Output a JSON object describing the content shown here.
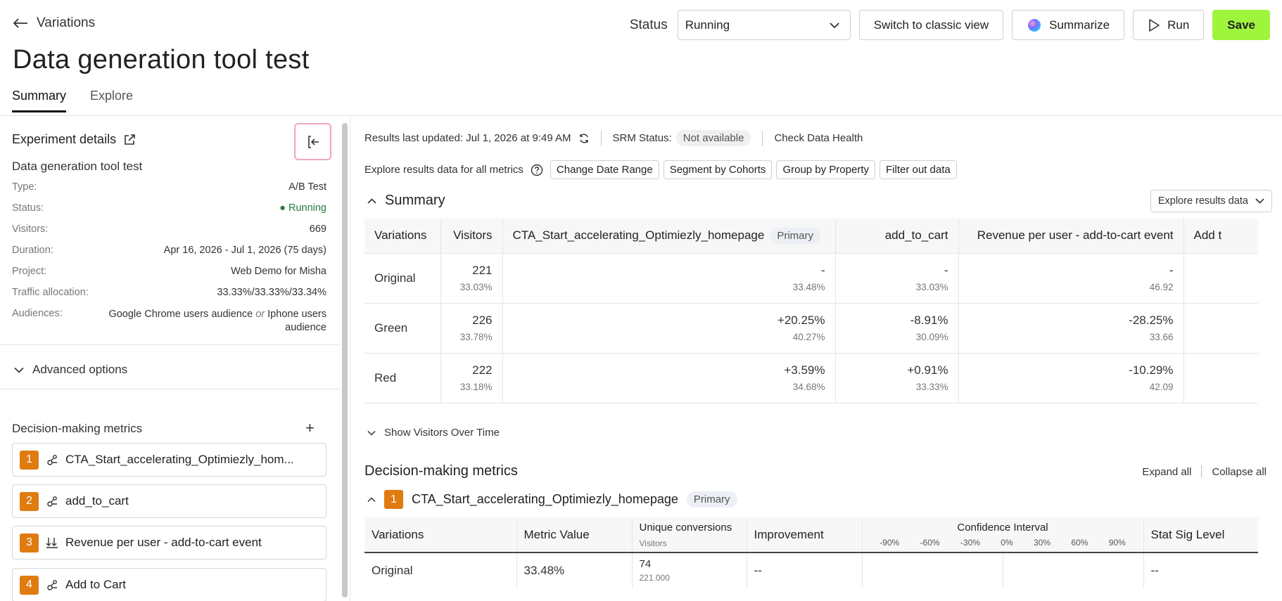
{
  "header": {
    "back_label": "Variations",
    "title": "Data generation tool test",
    "status_label": "Status",
    "status_value": "Running",
    "classic_view_label": "Switch to classic view",
    "summarize_label": "Summarize",
    "run_label": "Run",
    "save_label": "Save",
    "save_color": "#9ef53c"
  },
  "tabs": [
    {
      "label": "Summary",
      "active": true
    },
    {
      "label": "Explore",
      "active": false
    }
  ],
  "sidebar": {
    "details_title": "Experiment details",
    "experiment_name": "Data generation tool test",
    "details": {
      "type_key": "Type:",
      "type_val": "A/B Test",
      "status_key": "Status:",
      "status_val": "● Running",
      "visitors_key": "Visitors:",
      "visitors_val": "669",
      "duration_key": "Duration:",
      "duration_val": "Apr 16, 2026 - Jul 1, 2026 (75 days)",
      "project_key": "Project:",
      "project_val": "Web Demo for Misha",
      "traffic_key": "Traffic allocation:",
      "traffic_val": "33.33%/33.33%/33.34%",
      "audiences_key": "Audiences:",
      "audience_1": "Google Chrome users audience",
      "audience_or": "or",
      "audience_2a": "Iphone users",
      "audience_2b": "audience"
    },
    "advanced_label": "Advanced options",
    "metrics_title": "Decision-making metrics",
    "metrics": [
      {
        "num": "1",
        "name": "CTA_Start_accelerating_Optimiezly_hom...",
        "icon": "conversion-icon"
      },
      {
        "num": "2",
        "name": "add_to_cart",
        "icon": "conversion-icon"
      },
      {
        "num": "3",
        "name": "Revenue per user - add-to-cart event",
        "icon": "revenue-icon"
      },
      {
        "num": "4",
        "name": "Add to Cart",
        "icon": "conversion-icon"
      }
    ]
  },
  "results": {
    "last_updated": "Results last updated: Jul 1, 2026 at 9:49 AM",
    "srm_label": "SRM Status:",
    "srm_value": "Not available",
    "check_health": "Check Data Health",
    "explore_all": "Explore results data for all metrics",
    "chips": [
      "Change Date Range",
      "Segment by Cohorts",
      "Group by Property",
      "Filter out data"
    ],
    "summary_title": "Summary",
    "explore_dropdown": "Explore results data"
  },
  "summary_table": {
    "headers": {
      "variations": "Variations",
      "visitors": "Visitors",
      "metric1": "CTA_Start_accelerating_Optimiezly_homepage",
      "primary": "Primary",
      "metric2": "add_to_cart",
      "metric3": "Revenue per user - add-to-cart event",
      "metric4": "Add t"
    },
    "rows": [
      {
        "name": "Original",
        "visitors": "221",
        "visitors_pct": "33.03%",
        "m1": "-",
        "m1_sub": "33.48%",
        "m2": "-",
        "m2_sub": "33.03%",
        "m3": "-",
        "m3_sub": "46.92"
      },
      {
        "name": "Green",
        "visitors": "226",
        "visitors_pct": "33.78%",
        "m1": "+20.25%",
        "m1_sub": "40.27%",
        "m2": "-8.91%",
        "m2_sub": "30.09%",
        "m3": "-28.25%",
        "m3_sub": "33.66"
      },
      {
        "name": "Red",
        "visitors": "222",
        "visitors_pct": "33.18%",
        "m1": "+3.59%",
        "m1_sub": "34.68%",
        "m2": "+0.91%",
        "m2_sub": "33.33%",
        "m3": "-10.29%",
        "m3_sub": "42.09"
      }
    ]
  },
  "show_visitors": "Show Visitors Over Time",
  "decision_metrics": {
    "title": "Decision-making metrics",
    "expand_all": "Expand all",
    "collapse_all": "Collapse all",
    "metric_num": "1",
    "metric_name": "CTA_Start_accelerating_Optimiezly_homepage",
    "primary": "Primary",
    "headers": {
      "variations": "Variations",
      "metric_value": "Metric Value",
      "unique_conv": "Unique conversions",
      "unique_conv_sub": "Visitors",
      "improvement": "Improvement",
      "ci": "Confidence Interval",
      "ci_ticks": [
        "-90%",
        "-60%",
        "-30%",
        "0%",
        "30%",
        "60%",
        "90%"
      ],
      "stat_sig": "Stat Sig Level"
    },
    "rows": [
      {
        "name": "Original",
        "metric_value": "33.48%",
        "conversions": "74",
        "visitors": "221.000",
        "improvement": "--",
        "stat_sig": "--"
      }
    ]
  },
  "colors": {
    "accent_orange": "#e07b10",
    "running_green": "#2c7a3d",
    "highlight_pink": "#f2a6b8"
  }
}
